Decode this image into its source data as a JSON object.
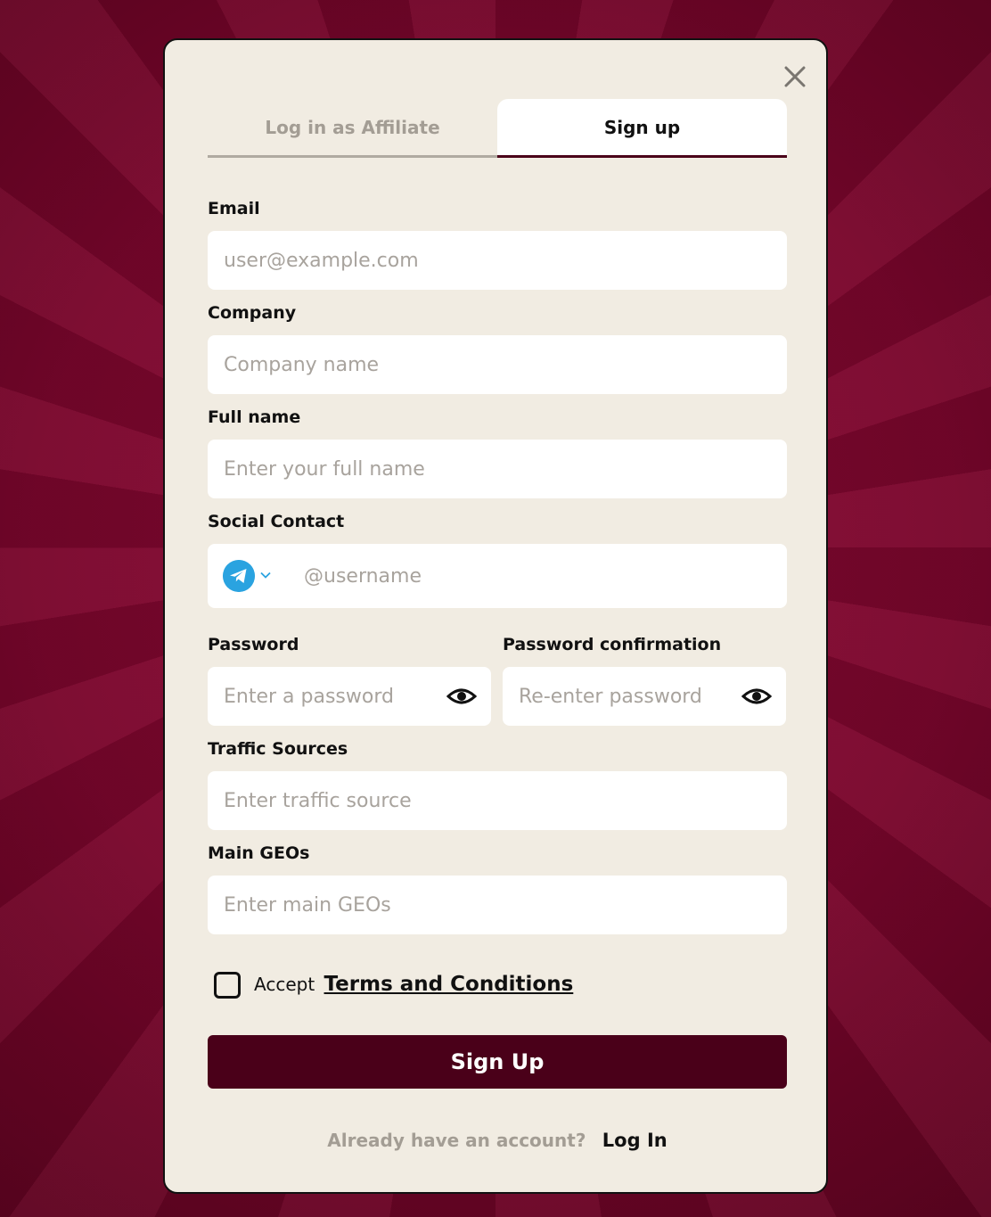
{
  "tabs": {
    "login": "Log in as Affiliate",
    "signup": "Sign up"
  },
  "fields": {
    "email": {
      "label": "Email",
      "placeholder": "user@example.com"
    },
    "company": {
      "label": "Company",
      "placeholder": "Company name"
    },
    "full_name": {
      "label": "Full name",
      "placeholder": "Enter your full name"
    },
    "social": {
      "label": "Social Contact",
      "placeholder": "@username",
      "icon": "telegram-icon"
    },
    "password": {
      "label": "Password",
      "placeholder": "Enter a password"
    },
    "password_confirmation": {
      "label": "Password confirmation",
      "placeholder": "Re-enter password"
    },
    "traffic": {
      "label": "Traffic Sources",
      "placeholder": "Enter traffic source"
    },
    "geos": {
      "label": "Main GEOs",
      "placeholder": "Enter main GEOs"
    }
  },
  "terms": {
    "prefix": "Accept",
    "link": "Terms and Conditions"
  },
  "submit_label": "Sign Up",
  "footer": {
    "question": "Already have an account?",
    "login_link": "Log In"
  },
  "colors": {
    "brand": "#4a0019",
    "panel": "#f1ece2",
    "telegram": "#2aa3e0"
  }
}
